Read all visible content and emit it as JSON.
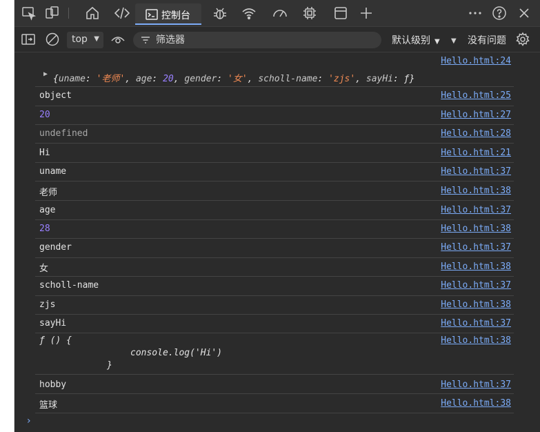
{
  "tabbar": {
    "console_label": "控制台",
    "icons": [
      "inspect-icon",
      "device-toggle-icon",
      "welcome-home-icon",
      "elements-icon",
      "console-icon",
      "sources-bug-icon",
      "network-wifi-icon",
      "performance-gauge-icon",
      "memory-chip-icon",
      "application-window-icon",
      "add-tab-icon",
      "more-icon",
      "help-icon",
      "close-icon"
    ]
  },
  "console_toolbar": {
    "context": "top",
    "filter_placeholder": "筛选器",
    "level": "默认级别",
    "issues": "没有问题"
  },
  "log": {
    "rows": [
      {
        "id": "r0",
        "src": "Hello.html:24"
      },
      {
        "id": "r1",
        "msg": "object",
        "src": "Hello.html:25"
      },
      {
        "id": "r2",
        "msg": "20",
        "src": "Hello.html:27"
      },
      {
        "id": "r3",
        "msg": "undefined",
        "src": "Hello.html:28"
      },
      {
        "id": "r4",
        "msg": "Hi",
        "src": "Hello.html:21"
      },
      {
        "id": "r5",
        "msg": "uname",
        "src": "Hello.html:37"
      },
      {
        "id": "r6",
        "msg": "老师",
        "src": "Hello.html:38"
      },
      {
        "id": "r7",
        "msg": "age",
        "src": "Hello.html:37"
      },
      {
        "id": "r8",
        "msg": "28",
        "src": "Hello.html:38"
      },
      {
        "id": "r9",
        "msg": "gender",
        "src": "Hello.html:37"
      },
      {
        "id": "r10",
        "msg": "女",
        "src": "Hello.html:38"
      },
      {
        "id": "r11",
        "msg": "scholl-name",
        "src": "Hello.html:37"
      },
      {
        "id": "r12",
        "msg": "zjs",
        "src": "Hello.html:38"
      },
      {
        "id": "r13",
        "msg": "sayHi",
        "src": "Hello.html:37"
      },
      {
        "id": "r14",
        "src": "Hello.html:38"
      },
      {
        "id": "r15",
        "msg": "hobby",
        "src": "Hello.html:37"
      },
      {
        "id": "r16",
        "msg": "篮球",
        "src": "Hello.html:38"
      }
    ],
    "object_preview": {
      "open": "{",
      "k1": "uname",
      "v1": "'老师'",
      "k2": "age",
      "v2": "20",
      "k3": "gender",
      "v3": "'女'",
      "k4": "scholl-name",
      "v4": "'zjs'",
      "k5": "sayHi",
      "v5": "ƒ",
      "close": "}"
    },
    "function_preview": {
      "line1": "ƒ () {",
      "line2": "console.log('Hi')",
      "line3": "}"
    }
  },
  "prompt_symbol": "›"
}
